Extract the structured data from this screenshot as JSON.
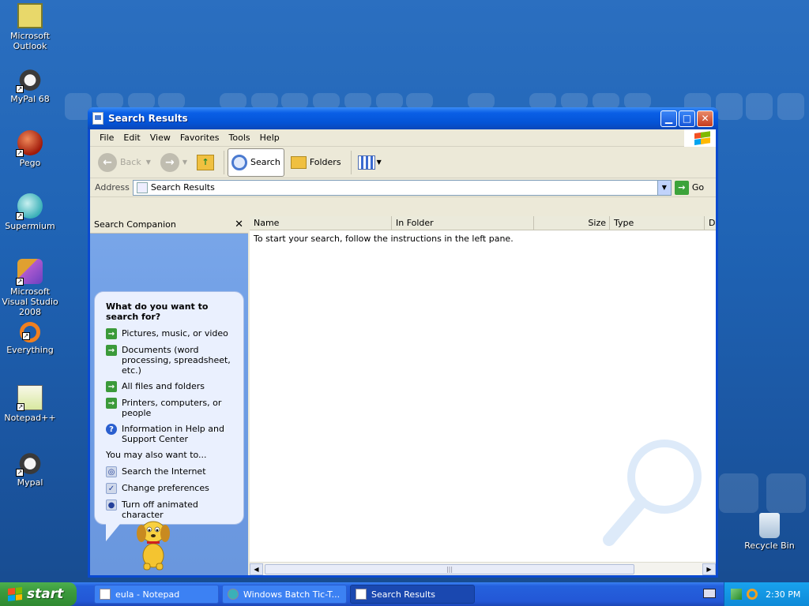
{
  "desktop": {
    "icons": [
      {
        "label": "Microsoft\nOutlook",
        "icon": "outlook-icon"
      },
      {
        "label": "MyPal 68",
        "icon": "mypal-icon"
      },
      {
        "label": "Pego",
        "icon": "pego-icon"
      },
      {
        "label": "Supermium",
        "icon": "supermium-icon"
      },
      {
        "label": "Microsoft Visual Studio 2008",
        "icon": "visual-studio-icon"
      },
      {
        "label": "Everything",
        "icon": "everything-icon"
      },
      {
        "label": "Notepad++",
        "icon": "notepadpp-icon"
      },
      {
        "label": "Mypal",
        "icon": "mypal-icon"
      }
    ],
    "recycle_bin": "Recycle Bin"
  },
  "window": {
    "title": "Search Results",
    "menu": [
      "File",
      "Edit",
      "View",
      "Favorites",
      "Tools",
      "Help"
    ],
    "toolbar": {
      "back": "Back",
      "search": "Search",
      "folders": "Folders"
    },
    "address": {
      "label": "Address",
      "value": "Search Results",
      "go": "Go"
    },
    "companion": {
      "title": "Search Companion",
      "question": "What do you want to search for?",
      "options": [
        "Pictures, music, or video",
        "Documents (word processing, spreadsheet, etc.)",
        "All files and folders",
        "Printers, computers, or people",
        "Information in Help and Support Center"
      ],
      "also_label": "You may also want to...",
      "also_options": [
        "Search the Internet",
        "Change preferences",
        "Turn off animated character"
      ]
    },
    "columns": [
      "Name",
      "In Folder",
      "Size",
      "Type",
      "D"
    ],
    "empty_message": "To start your search, follow the instructions in the left pane."
  },
  "taskbar": {
    "start": "start",
    "tasks": [
      "eula - Notepad",
      "Windows Batch Tic-T...",
      "Search Results"
    ],
    "clock": "2:30 PM"
  },
  "colors": {
    "desktop": "#1f63b4",
    "titlebar": "#0453d6",
    "start": "#3b9a3c",
    "tray": "#0e8ad8"
  }
}
